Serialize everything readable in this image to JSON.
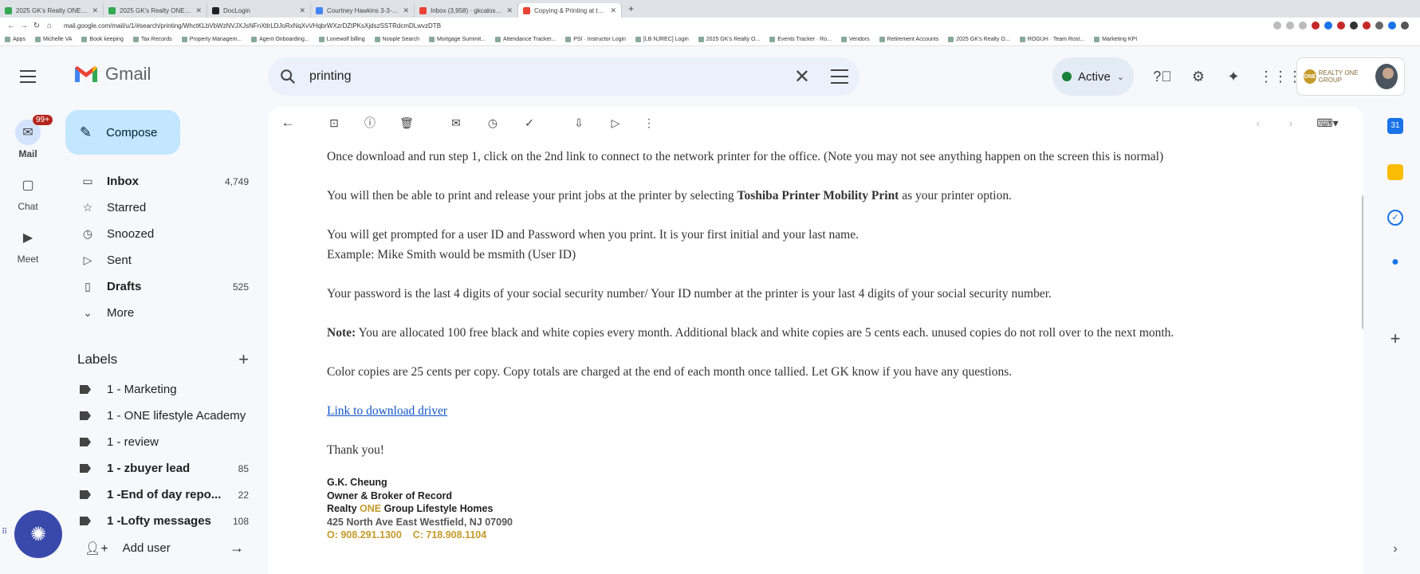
{
  "browser": {
    "tabs": [
      {
        "title": "2025 GK's Realty ONE GS · Go...",
        "color": "#34a853"
      },
      {
        "title": "2025 GK's Realty ONE GS · Go...",
        "color": "#34a853"
      },
      {
        "title": "DocLogin",
        "color": "#202124"
      },
      {
        "title": "Courtney Hawkins 3-3-2025 su...",
        "color": "#4285f4"
      },
      {
        "title": "Inbox (3,958) · gkcalos@gmai...",
        "color": "#ea4335"
      },
      {
        "title": "Copying & Printing at the Offic...",
        "color": "#ea4335"
      }
    ],
    "url": "mail.google.com/mail/u/1/#search/printing/WhctKLbVbWzNVJXJsNFnXtlrLDJoRxNqXvVHqbrWXzrDZtPKsXjdszSSTRdcmDLwvzDTB",
    "bookmarks": [
      "Apps",
      "Michelle VA",
      "Book keeping",
      "Tax Records",
      "Property Managem...",
      "Agent Onboarding...",
      "Lonewolf billing",
      "Noople Search",
      "Mortgage Summit...",
      "Attendance Tracker...",
      "PSI · Instructor Login",
      "[LB NJREC] Login",
      "2025 GK's Realty O...",
      "Events Tracker · Ro...",
      "Vendors",
      "Retirement Accounts",
      "2025 GK's Realty O...",
      "ROGUH · Team Rost...",
      "Marketing KPI"
    ]
  },
  "header": {
    "logo_text": "Gmail",
    "search_value": "printing",
    "status_label": "Active",
    "brand_text": "REALTY ONE GROUP"
  },
  "rail": {
    "mail_label": "Mail",
    "mail_badge": "99+",
    "chat_label": "Chat",
    "meet_label": "Meet"
  },
  "compose_label": "Compose",
  "nav": [
    {
      "label": "Inbox",
      "count": "4,749",
      "icon": "inbox-icon",
      "glyph": "▭",
      "bold": true
    },
    {
      "label": "Starred",
      "count": "",
      "icon": "star-icon",
      "glyph": "☆",
      "bold": false
    },
    {
      "label": "Snoozed",
      "count": "",
      "icon": "clock-icon",
      "glyph": "◷",
      "bold": false
    },
    {
      "label": "Sent",
      "count": "",
      "icon": "send-icon",
      "glyph": "▷",
      "bold": false
    },
    {
      "label": "Drafts",
      "count": "525",
      "icon": "draft-icon",
      "glyph": "▯",
      "bold": true
    },
    {
      "label": "More",
      "count": "",
      "icon": "chevron-down-icon",
      "glyph": "⌄",
      "bold": false
    }
  ],
  "labels_heading": "Labels",
  "labels": [
    {
      "label": "1 - Marketing",
      "count": "",
      "bold": false
    },
    {
      "label": "1 - ONE lifestyle Academy",
      "count": "",
      "bold": false
    },
    {
      "label": "1 - review",
      "count": "",
      "bold": false
    },
    {
      "label": "1 - zbuyer lead",
      "count": "85",
      "bold": true
    },
    {
      "label": "1 -End of day repo...",
      "count": "22",
      "bold": true
    },
    {
      "label": "1 -Lofty messages",
      "count": "108",
      "bold": true
    }
  ],
  "add_user_label": "Add user",
  "email": {
    "p1": "Once download and run step 1, click on the 2nd link to connect to the network printer for the office.  (Note you may not see anything happen on the screen this is normal)",
    "p2_pre": "You will then be able to print and release your print jobs at the printer by selecting ",
    "p2_bold": "Toshiba Printer Mobility Print",
    "p2_post": " as your printer option.",
    "p3_line1": "You will get prompted for a user ID and Password when you print.  It is your first initial and your last name.",
    "p3_line2": "Example: Mike Smith would be  msmith (User ID)",
    "p4": "Your password is the last 4 digits of your social security number/ Your ID number at the printer is your last 4 digits of your social security number.",
    "p5_bold": "Note:",
    "p5_rest": "  You are allocated 100 free black and white copies every month.  Additional black and white copies are 5 cents each.  unused copies do not roll over to the next month.",
    "p6": "Color copies are 25 cents per copy.  Copy totals are charged at the end of each month once tallied.  Let GK know if you have any questions.",
    "link": "Link to download driver",
    "thanks": "Thank you!",
    "sig_name": "G.K. Cheung",
    "sig_title": "Owner & Broker of Record",
    "sig_company_pre": "Realty ",
    "sig_company_one": "ONE",
    "sig_company_post": " Group Lifestyle Homes",
    "sig_address": "425 North Ave East Westfield, NJ 07090",
    "sig_office": "O: 908.291.1300",
    "sig_cell": "C: 718.908.1104"
  },
  "colors": {
    "accent": "#c2e7ff",
    "gold": "#c59a2a",
    "link": "#1155cc",
    "badge": "#b3261e",
    "active_dot": "#188038"
  }
}
